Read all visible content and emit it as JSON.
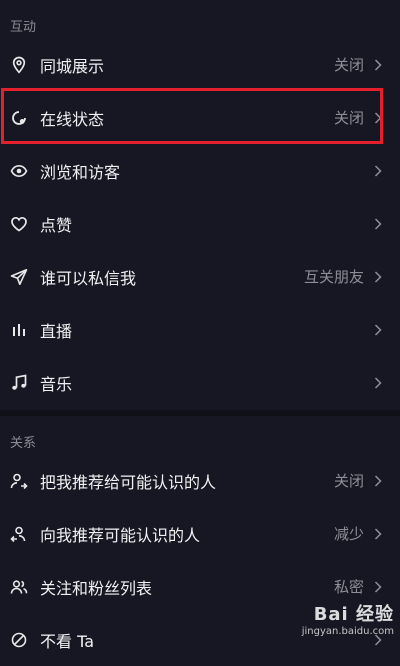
{
  "sections": {
    "interaction": "互动",
    "relations": "关系"
  },
  "rows": [
    {
      "label": "同城展示",
      "value": "关闭",
      "icon": "location-pin-icon"
    },
    {
      "label": "在线状态",
      "value": "关闭",
      "icon": "online-status-icon"
    },
    {
      "label": "浏览和访客",
      "value": "",
      "icon": "eye-icon"
    },
    {
      "label": "点赞",
      "value": "",
      "icon": "heart-icon"
    },
    {
      "label": "谁可以私信我",
      "value": "互关朋友",
      "icon": "send-icon"
    },
    {
      "label": "直播",
      "value": "",
      "icon": "live-bars-icon"
    },
    {
      "label": "音乐",
      "value": "",
      "icon": "music-note-icon"
    },
    {
      "label": "把我推荐给可能认识的人",
      "value": "关闭",
      "icon": "recommend-me-icon"
    },
    {
      "label": "向我推荐可能认识的人",
      "value": "减少",
      "icon": "recommend-to-me-icon"
    },
    {
      "label": "关注和粉丝列表",
      "value": "私密",
      "icon": "followers-icon"
    },
    {
      "label": "不看 Ta",
      "value": "",
      "icon": "hide-icon"
    }
  ],
  "watermark": {
    "brand": "Bai 经验",
    "url": "jingyan.baidu.com"
  },
  "colors": {
    "background": "#161722",
    "highlight": "#e3202b"
  }
}
